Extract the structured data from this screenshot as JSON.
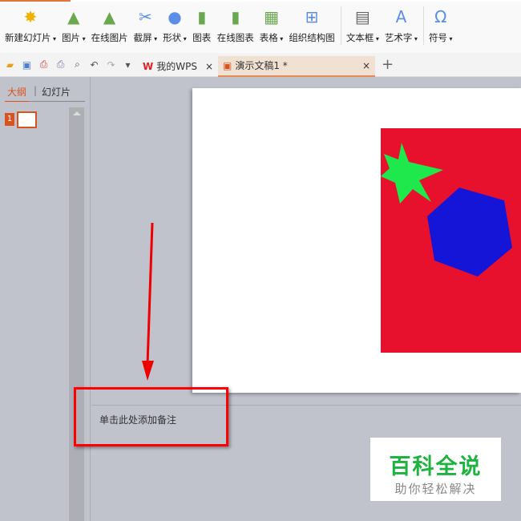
{
  "ribbon": [
    {
      "label": "新建幻灯片",
      "dropdown": true,
      "icon": "new-slide-icon"
    },
    {
      "label": "图片",
      "dropdown": true,
      "icon": "picture-icon"
    },
    {
      "label": "在线图片",
      "dropdown": false,
      "icon": "online-picture-icon"
    },
    {
      "label": "截屏",
      "dropdown": true,
      "icon": "screenshot-icon"
    },
    {
      "label": "形状",
      "dropdown": true,
      "icon": "shapes-icon"
    },
    {
      "label": "图表",
      "dropdown": false,
      "icon": "chart-icon"
    },
    {
      "label": "在线图表",
      "dropdown": false,
      "icon": "online-chart-icon"
    },
    {
      "label": "表格",
      "dropdown": true,
      "icon": "table-icon"
    },
    {
      "label": "组织结构图",
      "dropdown": false,
      "icon": "org-chart-icon"
    },
    {
      "label": "文本框",
      "dropdown": true,
      "icon": "textbox-icon"
    },
    {
      "label": "艺术字",
      "dropdown": true,
      "icon": "wordart-icon"
    },
    {
      "label": "符号",
      "dropdown": true,
      "icon": "symbol-icon"
    }
  ],
  "tabs": {
    "wps": "我的WPS",
    "doc": "演示文稿1 *",
    "close": "×",
    "new": "+"
  },
  "panel": {
    "outline": "大纲",
    "slides": "幻灯片",
    "slide_num": "1"
  },
  "notes": {
    "placeholder": "单击此处添加备注"
  },
  "watermark": {
    "title": "百科全说",
    "subtitle": "助你轻松解决"
  },
  "colors": {
    "accent": "#d9531e",
    "red": "#e8112d",
    "green": "#1ee84c",
    "blue": "#1515d8"
  }
}
